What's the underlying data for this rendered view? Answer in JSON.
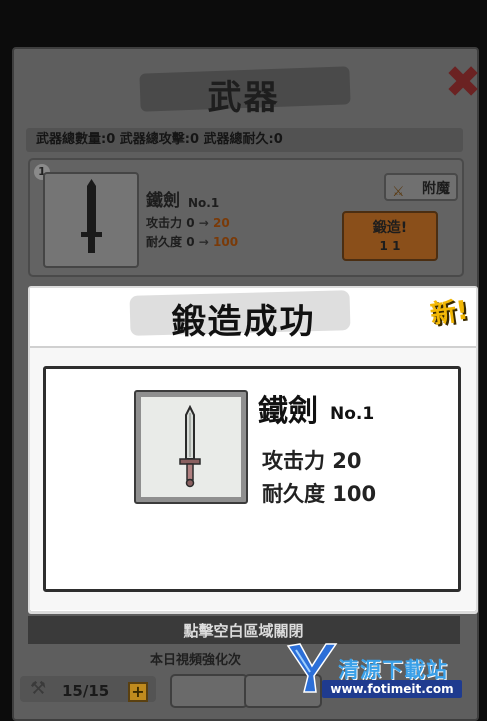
{
  "background_panel": {
    "title": "武器",
    "close_icon": "close-x-icon",
    "stats": "武器總數量:0  武器總攻擊:0  武器總耐久:0",
    "weapon_card": {
      "index": "1",
      "name": "鐵劍",
      "number": "No.1",
      "attack_label": "攻击力",
      "attack_from": "0",
      "attack_to": "20",
      "durability_label": "耐久度",
      "durability_from": "0",
      "durability_to": "100",
      "arrow": "→",
      "enchant_button": "附魔",
      "forge_button": "鍛造!",
      "forge_cost": "1  1"
    }
  },
  "dialog": {
    "title": "鍛造成功",
    "new_badge": "新!",
    "item": {
      "name": "鐵劍",
      "number": "No.1",
      "attack": "攻击力 20",
      "durability": "耐久度 100",
      "icon": "iron-sword-icon"
    }
  },
  "footer": {
    "close_hint": "點擊空白區域關閉",
    "daily_text": "本日視頻強化次",
    "energy": "15/15",
    "plus": "+"
  },
  "watermark": {
    "text": "清源下載站",
    "url": "www.fotimeit.com"
  },
  "colors": {
    "accent_gold": "#f2b705",
    "forge_orange": "#8a4f1a",
    "watermark_blue": "#3aa0e8"
  }
}
